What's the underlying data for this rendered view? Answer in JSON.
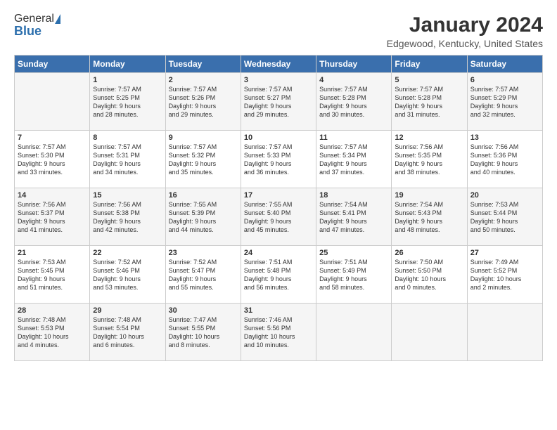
{
  "header": {
    "logo_general": "General",
    "logo_blue": "Blue",
    "main_title": "January 2024",
    "subtitle": "Edgewood, Kentucky, United States"
  },
  "days_of_week": [
    "Sunday",
    "Monday",
    "Tuesday",
    "Wednesday",
    "Thursday",
    "Friday",
    "Saturday"
  ],
  "weeks": [
    [
      {
        "day": "",
        "content": ""
      },
      {
        "day": "1",
        "content": "Sunrise: 7:57 AM\nSunset: 5:25 PM\nDaylight: 9 hours\nand 28 minutes."
      },
      {
        "day": "2",
        "content": "Sunrise: 7:57 AM\nSunset: 5:26 PM\nDaylight: 9 hours\nand 29 minutes."
      },
      {
        "day": "3",
        "content": "Sunrise: 7:57 AM\nSunset: 5:27 PM\nDaylight: 9 hours\nand 29 minutes."
      },
      {
        "day": "4",
        "content": "Sunrise: 7:57 AM\nSunset: 5:28 PM\nDaylight: 9 hours\nand 30 minutes."
      },
      {
        "day": "5",
        "content": "Sunrise: 7:57 AM\nSunset: 5:28 PM\nDaylight: 9 hours\nand 31 minutes."
      },
      {
        "day": "6",
        "content": "Sunrise: 7:57 AM\nSunset: 5:29 PM\nDaylight: 9 hours\nand 32 minutes."
      }
    ],
    [
      {
        "day": "7",
        "content": "Sunrise: 7:57 AM\nSunset: 5:30 PM\nDaylight: 9 hours\nand 33 minutes."
      },
      {
        "day": "8",
        "content": "Sunrise: 7:57 AM\nSunset: 5:31 PM\nDaylight: 9 hours\nand 34 minutes."
      },
      {
        "day": "9",
        "content": "Sunrise: 7:57 AM\nSunset: 5:32 PM\nDaylight: 9 hours\nand 35 minutes."
      },
      {
        "day": "10",
        "content": "Sunrise: 7:57 AM\nSunset: 5:33 PM\nDaylight: 9 hours\nand 36 minutes."
      },
      {
        "day": "11",
        "content": "Sunrise: 7:57 AM\nSunset: 5:34 PM\nDaylight: 9 hours\nand 37 minutes."
      },
      {
        "day": "12",
        "content": "Sunrise: 7:56 AM\nSunset: 5:35 PM\nDaylight: 9 hours\nand 38 minutes."
      },
      {
        "day": "13",
        "content": "Sunrise: 7:56 AM\nSunset: 5:36 PM\nDaylight: 9 hours\nand 40 minutes."
      }
    ],
    [
      {
        "day": "14",
        "content": "Sunrise: 7:56 AM\nSunset: 5:37 PM\nDaylight: 9 hours\nand 41 minutes."
      },
      {
        "day": "15",
        "content": "Sunrise: 7:56 AM\nSunset: 5:38 PM\nDaylight: 9 hours\nand 42 minutes."
      },
      {
        "day": "16",
        "content": "Sunrise: 7:55 AM\nSunset: 5:39 PM\nDaylight: 9 hours\nand 44 minutes."
      },
      {
        "day": "17",
        "content": "Sunrise: 7:55 AM\nSunset: 5:40 PM\nDaylight: 9 hours\nand 45 minutes."
      },
      {
        "day": "18",
        "content": "Sunrise: 7:54 AM\nSunset: 5:41 PM\nDaylight: 9 hours\nand 47 minutes."
      },
      {
        "day": "19",
        "content": "Sunrise: 7:54 AM\nSunset: 5:43 PM\nDaylight: 9 hours\nand 48 minutes."
      },
      {
        "day": "20",
        "content": "Sunrise: 7:53 AM\nSunset: 5:44 PM\nDaylight: 9 hours\nand 50 minutes."
      }
    ],
    [
      {
        "day": "21",
        "content": "Sunrise: 7:53 AM\nSunset: 5:45 PM\nDaylight: 9 hours\nand 51 minutes."
      },
      {
        "day": "22",
        "content": "Sunrise: 7:52 AM\nSunset: 5:46 PM\nDaylight: 9 hours\nand 53 minutes."
      },
      {
        "day": "23",
        "content": "Sunrise: 7:52 AM\nSunset: 5:47 PM\nDaylight: 9 hours\nand 55 minutes."
      },
      {
        "day": "24",
        "content": "Sunrise: 7:51 AM\nSunset: 5:48 PM\nDaylight: 9 hours\nand 56 minutes."
      },
      {
        "day": "25",
        "content": "Sunrise: 7:51 AM\nSunset: 5:49 PM\nDaylight: 9 hours\nand 58 minutes."
      },
      {
        "day": "26",
        "content": "Sunrise: 7:50 AM\nSunset: 5:50 PM\nDaylight: 10 hours\nand 0 minutes."
      },
      {
        "day": "27",
        "content": "Sunrise: 7:49 AM\nSunset: 5:52 PM\nDaylight: 10 hours\nand 2 minutes."
      }
    ],
    [
      {
        "day": "28",
        "content": "Sunrise: 7:48 AM\nSunset: 5:53 PM\nDaylight: 10 hours\nand 4 minutes."
      },
      {
        "day": "29",
        "content": "Sunrise: 7:48 AM\nSunset: 5:54 PM\nDaylight: 10 hours\nand 6 minutes."
      },
      {
        "day": "30",
        "content": "Sunrise: 7:47 AM\nSunset: 5:55 PM\nDaylight: 10 hours\nand 8 minutes."
      },
      {
        "day": "31",
        "content": "Sunrise: 7:46 AM\nSunset: 5:56 PM\nDaylight: 10 hours\nand 10 minutes."
      },
      {
        "day": "",
        "content": ""
      },
      {
        "day": "",
        "content": ""
      },
      {
        "day": "",
        "content": ""
      }
    ]
  ]
}
